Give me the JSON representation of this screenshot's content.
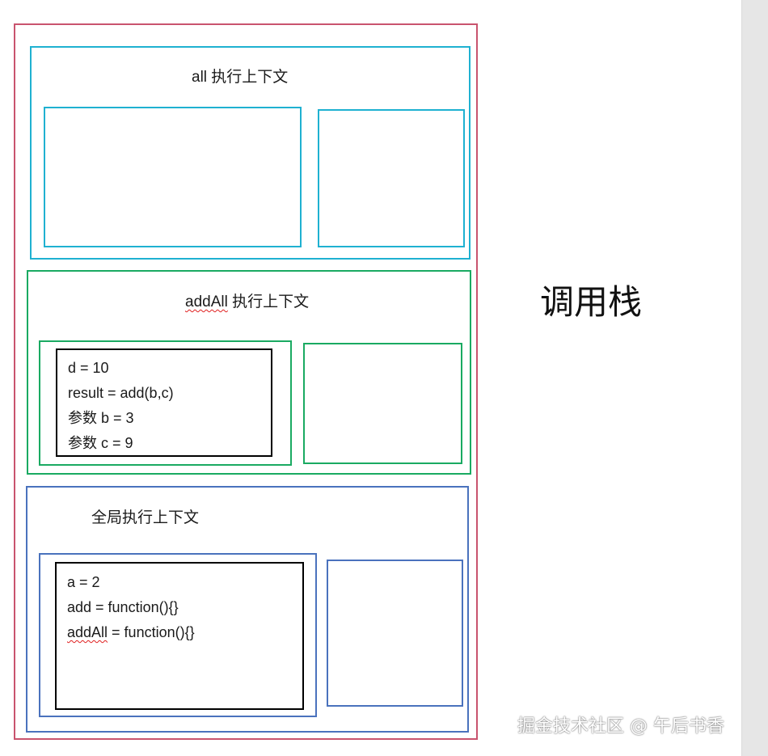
{
  "colors": {
    "outer": "#c9546e",
    "all": "#1fb1d1",
    "addAll": "#1aaa62",
    "global": "#4a72bd",
    "inner": "#000000"
  },
  "call_stack_label": "调用栈",
  "frames": {
    "all": {
      "title": "all 执行上下文"
    },
    "addAll": {
      "title_name": "addAll",
      "title_suffix": " 执行上下文",
      "variables": [
        "d = 10",
        "result = add(b,c)",
        "参数 b = 3",
        "参数 c = 9"
      ]
    },
    "global": {
      "title": "全局执行上下文",
      "variables": [
        "a = 2",
        "add = function(){}"
      ],
      "last_var_name": "addAll",
      "last_var_rest": " = function(){}"
    }
  },
  "watermark": "掘金技术社区 @ 午后书香"
}
